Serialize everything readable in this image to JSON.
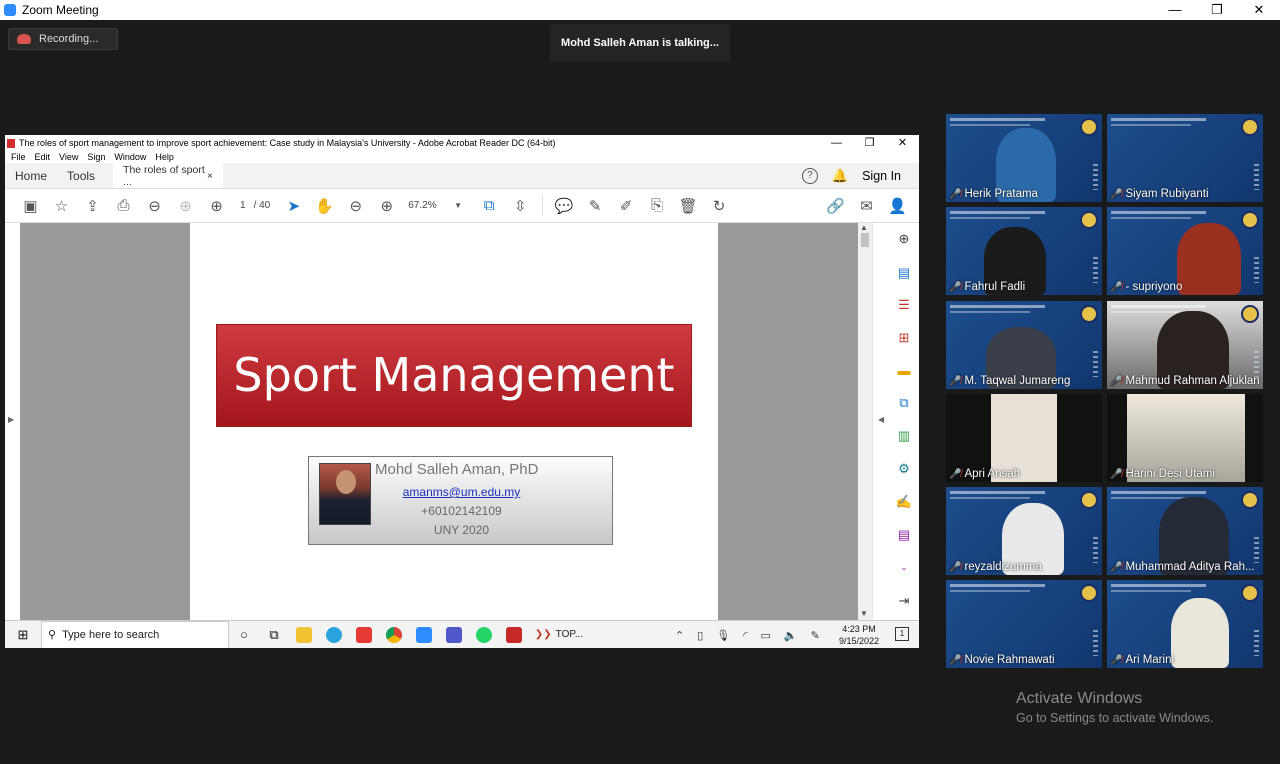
{
  "zoom": {
    "window_title": "Zoom Meeting",
    "recording_label": "Recording...",
    "talking_banner": "Mohd Salleh Aman is talking...",
    "window_controls": [
      "—",
      "❐",
      "✕"
    ]
  },
  "acrobat": {
    "title": "The roles of sport management to improve sport achievement: Case study in Malaysia's University - Adobe Acrobat Reader DC (64-bit)",
    "menu": [
      "File",
      "Edit",
      "View",
      "Sign",
      "Window",
      "Help"
    ],
    "tabs": {
      "home": "Home",
      "tools": "Tools",
      "document": "The roles of sport ...",
      "close": "×"
    },
    "sign_in": "Sign In",
    "page_current": "1",
    "page_total": "/ 40",
    "zoom_level": "67.2%",
    "slide": {
      "banner": "Sport Management",
      "name": "Mohd Salleh Aman, PhD",
      "email": "amanms@um.edu.my",
      "phone": "+60102142109",
      "org": "UNY 2020"
    }
  },
  "taskbar": {
    "search_placeholder": "Type here to search",
    "app_label": "TOP...",
    "time": "4:23 PM",
    "date": "9/15/2022",
    "notif_count": "1"
  },
  "participants": [
    {
      "name": "Herik Pratama"
    },
    {
      "name": "Siyam Rubiyanti"
    },
    {
      "name": "Fahrul Fadli"
    },
    {
      "name": "- supriyono"
    },
    {
      "name": "M. Taqwal Jumareng"
    },
    {
      "name": "Mahmud Rahman Aljuklan"
    },
    {
      "name": "Apri Ansah"
    },
    {
      "name": "Harini Desi Utami"
    },
    {
      "name": "reyzaldizumma"
    },
    {
      "name": "Muhammad Aditya Rah..."
    },
    {
      "name": "Novie Rahmawati"
    },
    {
      "name": "Ari Marini"
    }
  ],
  "watermark": {
    "line1": "Activate Windows",
    "line2": "Go to Settings to activate Windows."
  },
  "colors": {
    "zoom_blue": "#2d8cff",
    "banner_red": "#c0282d",
    "mute_red": "#e03a3a",
    "tile_blue": "#1d4e8f"
  }
}
